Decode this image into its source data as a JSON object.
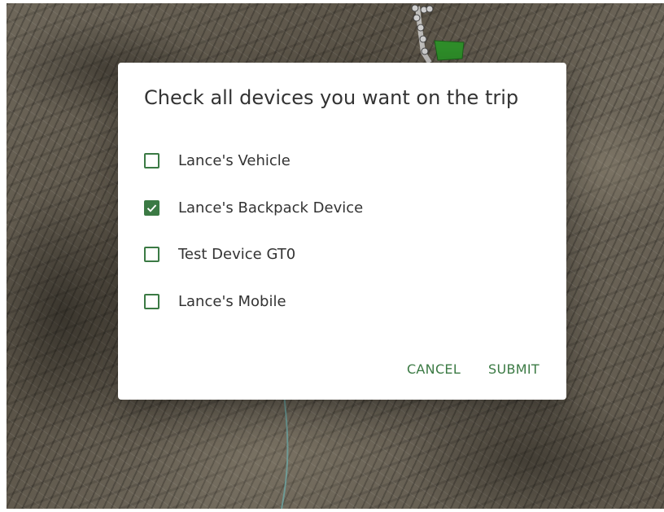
{
  "dialog": {
    "title": "Check all devices you want on the trip",
    "devices": [
      {
        "label": "Lance's Vehicle",
        "checked": false
      },
      {
        "label": "Lance's Backpack Device",
        "checked": true
      },
      {
        "label": "Test Device GT0",
        "checked": false
      },
      {
        "label": "Lance's Mobile",
        "checked": false
      }
    ],
    "cancel_label": "CANCEL",
    "submit_label": "SUBMIT"
  },
  "colors": {
    "accent": "#3b7a44",
    "marker": "#2f8f2a",
    "trail": "#6fa3a0"
  },
  "icons": {
    "checked": "check-icon",
    "marker": "green-flag-marker"
  }
}
